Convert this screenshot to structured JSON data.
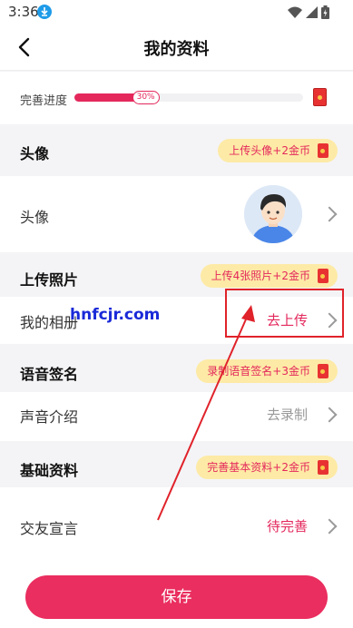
{
  "status_bar": {
    "time": "3:36"
  },
  "header": {
    "title": "我的资料"
  },
  "progress": {
    "label": "完善进度",
    "percent_text": "30%",
    "value": 0.3
  },
  "sections": {
    "avatar": {
      "title": "头像",
      "reward": "上传头像+2金币",
      "row_label": "头像"
    },
    "photos": {
      "title": "上传照片",
      "reward": "上传4张照片+2金币",
      "row_label": "我的相册",
      "row_value": "去上传"
    },
    "voice": {
      "title": "语音签名",
      "reward": "录制语音签名+3金币",
      "row_label": "声音介绍",
      "row_value": "去录制"
    },
    "basic": {
      "title": "基础资料",
      "reward": "完善基本资料+2金币",
      "row_label": "交友宣言",
      "row_value": "待完善"
    }
  },
  "watermark": "hnfcjr.com",
  "save_label": "保存",
  "colors": {
    "accent": "#ea2e5f",
    "pill_bg": "#fdeaa6",
    "highlight": "#e0222a"
  }
}
